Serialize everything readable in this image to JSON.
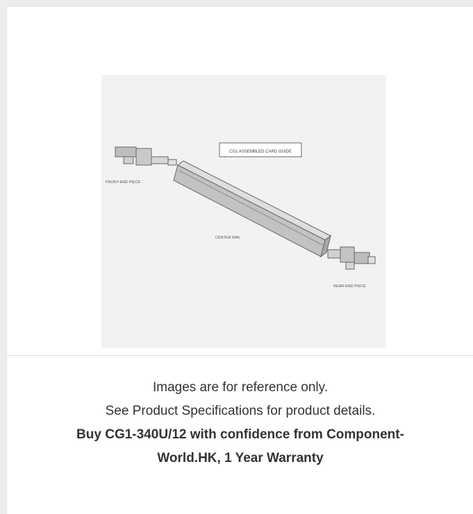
{
  "image": {
    "diagram_labels": {
      "title_box": "CG1 ASSEMBLED CARD GUIDE",
      "front": "FRONT-END PIECE",
      "center": "CENTER RAIL",
      "rear": "REAR-END PIECE"
    }
  },
  "caption": {
    "line1": "Images are for reference only.",
    "line2": "See Product Specifications for product details.",
    "bold_line1": "Buy CG1-340U/12 with confidence from Component-",
    "bold_line2": "World.HK, 1 Year Warranty"
  },
  "colors": {
    "page_bg": "#ededed",
    "card_bg": "#ffffff",
    "text": "#333333",
    "diagram_bg": "#f2f2f2"
  }
}
